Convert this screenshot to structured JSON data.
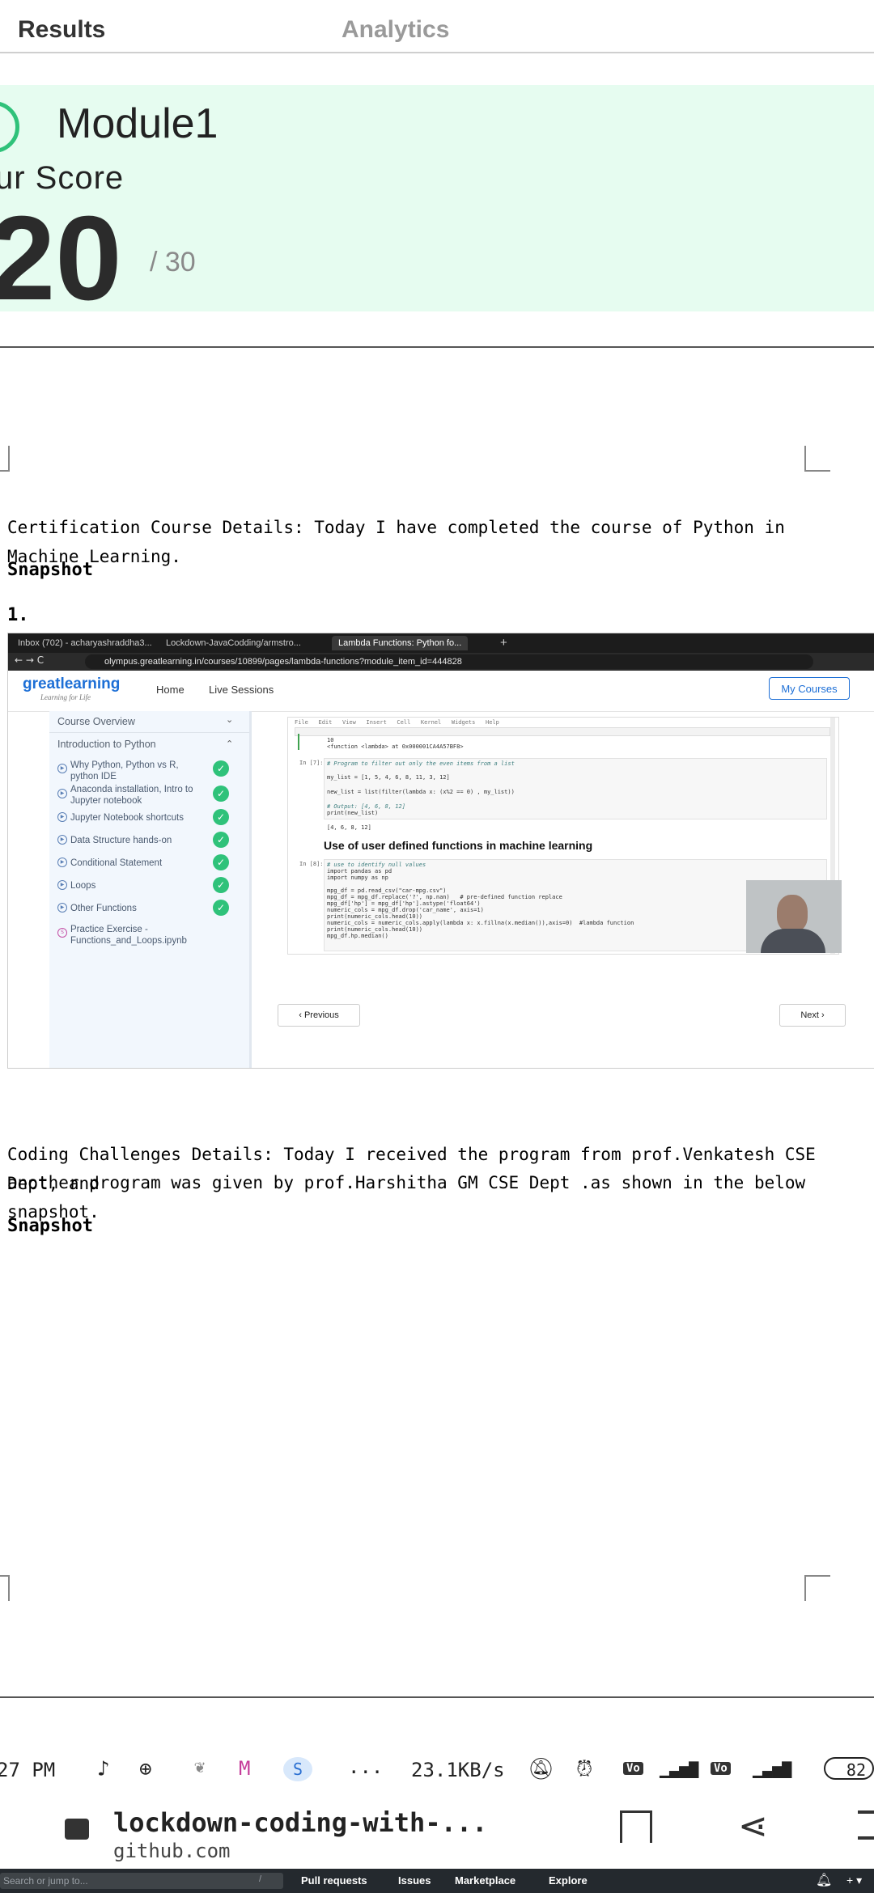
{
  "tabs": {
    "results": "Results",
    "analytics": "Analytics"
  },
  "score": {
    "module": "Module1",
    "label": "ur Score",
    "value": "20",
    "max": "/ 30"
  },
  "doc": {
    "cert_text": "Certification Course Details: Today I have completed the course of Python in Machine Learning.",
    "snapshot1": "Snapshot",
    "item1": "1.",
    "coding_text_1": "Coding Challenges Details: Today I received the program from prof.Venkatesh CSE Dept, and",
    "coding_text_2": "another program was given by prof.Harshitha GM CSE Dept .as shown in the below snapshot.",
    "snapshot2": "Snapshot"
  },
  "browser": {
    "tab1": "Inbox (702) - acharyashraddha3...",
    "tab2": "Lockdown-JavaCodding/armstro...",
    "tab3": "Lambda Functions: Python fo...",
    "url": "olympus.greatlearning.in/courses/10899/pages/lambda-functions?module_item_id=444828"
  },
  "site": {
    "logo": "greatlearning",
    "logo_sub": "Learning for Life",
    "nav_home": "Home",
    "nav_live": "Live Sessions",
    "my_courses": "My Courses",
    "sidebar": {
      "overview": "Course Overview",
      "intro": "Introduction to Python",
      "items": [
        "Why Python, Python vs R, python IDE",
        "Anaconda installation, Intro to Jupyter notebook",
        "Jupyter Notebook shortcuts",
        "Data Structure hands-on",
        "Conditional Statement",
        "Loops",
        "Other Functions",
        "Practice Exercise - Functions_and_Loops.ipynb"
      ]
    },
    "notebook": {
      "menu": "File   Edit   View   Insert   Cell   Kernel   Widgets   Help",
      "out1": "10",
      "out2": "<function <lambda> at 0x000001CA4A57BF8>",
      "in7": "In [7]:",
      "c1": "# Program to filter out only the even items from a list",
      "c2": "my_list = [1, 5, 4, 6, 8, 11, 3, 12]",
      "c3": "new_list = list(filter(lambda x: (x%2 == 0) , my_list))",
      "c4": "# Output: [4, 6, 8, 12]",
      "c5": "print(new_list)",
      "out3": "[4, 6, 8, 12]",
      "heading": "Use of user defined functions in machine learning",
      "in8": "In [8]:",
      "d1": "# use to identify null values",
      "d2": "import pandas as pd",
      "d3": "import numpy as np",
      "d4": "mpg_df = pd.read_csv(\"car-mpg.csv\")",
      "d5": "mpg_df = mpg_df.replace('?', np.nan)   # pre-defined function replace",
      "d6": "mpg_df['hp'] = mpg_df['hp'].astype('float64')",
      "d7": "numeric_cols = mpg_df.drop('car_name', axis=1)",
      "d8": "print(numeric_cols.head(10))",
      "d9": "numeric_cols = numeric_cols.apply(lambda x: x.fillna(x.median()),axis=0)  #lambda function",
      "d10": "print(numeric_cols.head(10))",
      "d11": "mpg_df.hp.median()"
    },
    "prev": "Previous",
    "next": "Next"
  },
  "status": {
    "time": "27 PM",
    "dots": "...",
    "speed": "23.1KB/s",
    "battery": "82"
  },
  "address": {
    "title": "lockdown-coding-with-...",
    "domain": "github.com"
  },
  "taskbar": {
    "search": "Search or jump to...",
    "slash": "/",
    "pulls": "Pull requests",
    "issues": "Issues",
    "market": "Marketplace",
    "explore": "Explore"
  }
}
